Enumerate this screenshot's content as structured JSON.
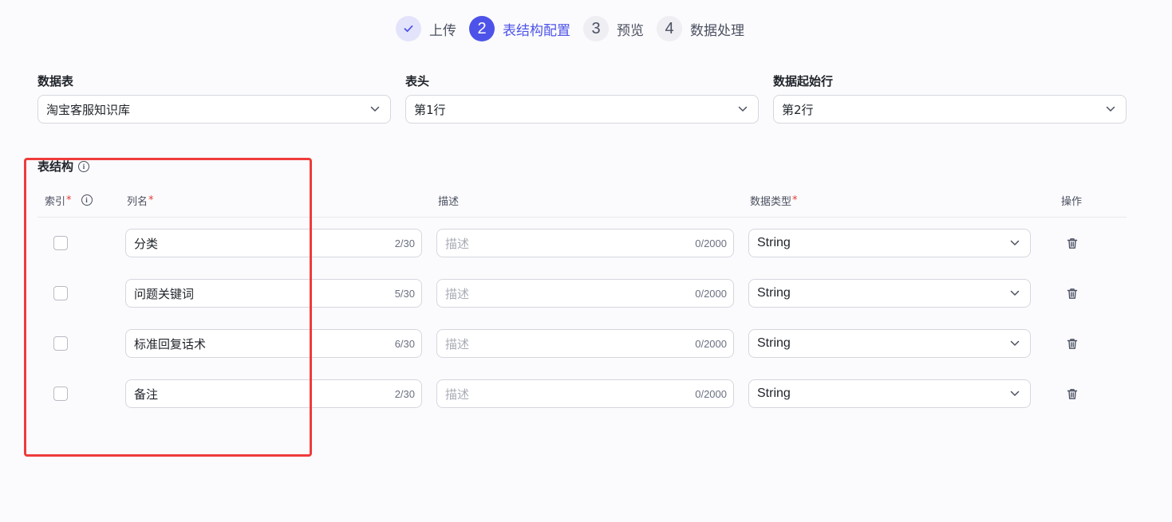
{
  "steps": [
    {
      "number": "✓",
      "label": "上传",
      "state": "done"
    },
    {
      "number": "2",
      "label": "表结构配置",
      "state": "active"
    },
    {
      "number": "3",
      "label": "预览",
      "state": "pending"
    },
    {
      "number": "4",
      "label": "数据处理",
      "state": "pending"
    }
  ],
  "config": {
    "table": {
      "label": "数据表",
      "value": "淘宝客服知识库"
    },
    "header": {
      "label": "表头",
      "value": "第1行"
    },
    "start_row": {
      "label": "数据起始行",
      "value": "第2行"
    }
  },
  "schema": {
    "title": "表结构",
    "columns": {
      "index": "索引",
      "name": "列名",
      "description": "描述",
      "data_type": "数据类型",
      "actions": "操作",
      "required_mark": "*"
    },
    "rows": [
      {
        "name": "分类",
        "name_count": "2/30",
        "desc_placeholder": "描述",
        "desc_count": "0/2000",
        "type": "String",
        "indexed": false
      },
      {
        "name": "问题关键词",
        "name_count": "5/30",
        "desc_placeholder": "描述",
        "desc_count": "0/2000",
        "type": "String",
        "indexed": false
      },
      {
        "name": "标准回复话术",
        "name_count": "6/30",
        "desc_placeholder": "描述",
        "desc_count": "0/2000",
        "type": "String",
        "indexed": false
      },
      {
        "name": "备注",
        "name_count": "2/30",
        "desc_placeholder": "描述",
        "desc_count": "0/2000",
        "type": "String",
        "indexed": false
      }
    ]
  },
  "colors": {
    "accent": "#4d53e8",
    "highlight": "#ef3b3b",
    "required": "#e53935"
  }
}
